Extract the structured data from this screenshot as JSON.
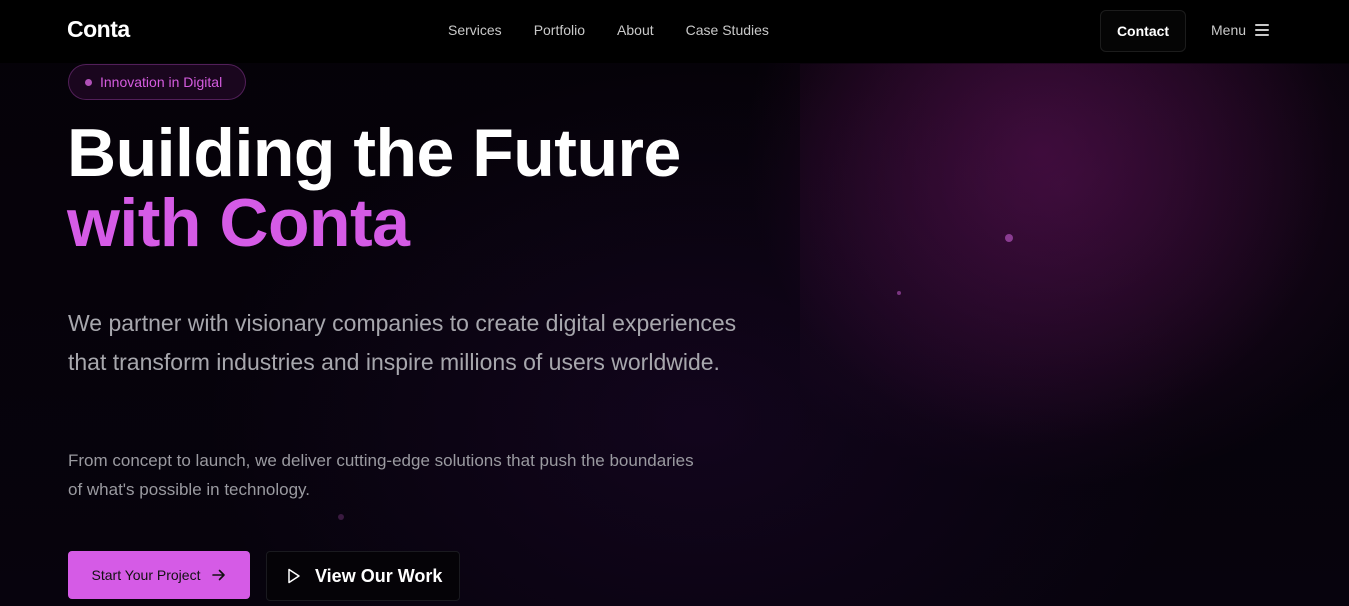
{
  "brand": {
    "logo": "Conta",
    "accent_color": "#d55be6"
  },
  "nav": {
    "items": [
      "Services",
      "Portfolio",
      "About",
      "Case Studies"
    ],
    "contact_label": "Contact",
    "menu_label": "Menu"
  },
  "hero": {
    "badge": "Innovation in Digital",
    "headline_line1": "Building the Future",
    "headline_line2": "with Conta",
    "lead": "We partner with visionary companies to create digital experiences that transform industries and inspire millions of users worldwide.",
    "sub": "From concept to launch, we deliver cutting-edge solutions that push the boundaries of what's possible in technology.",
    "cta_primary": "Start Your Project",
    "cta_secondary": "View Our Work"
  },
  "icons": {
    "menu": "hamburger-icon",
    "arrow": "arrow-right-icon",
    "play": "play-icon"
  }
}
